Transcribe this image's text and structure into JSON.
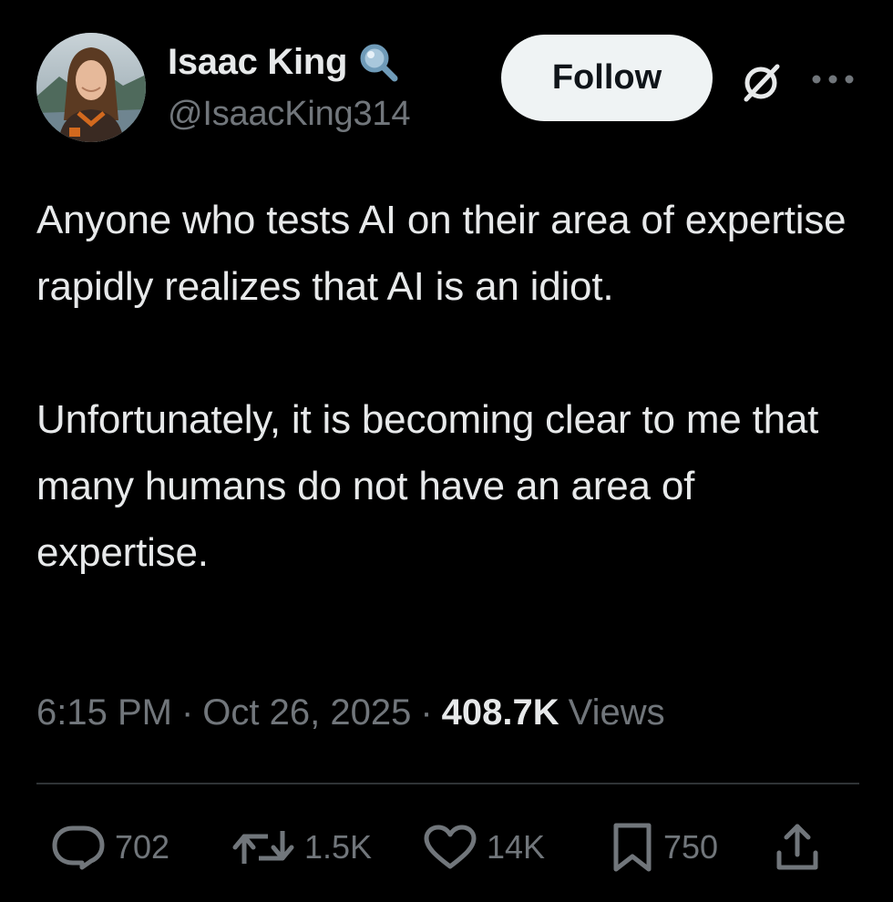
{
  "author": {
    "display_name": "Isaac King",
    "handle": "@IsaacKing314",
    "badge_icon": "magnifying-glass-icon",
    "avatar": "avatar"
  },
  "header": {
    "follow_label": "Follow",
    "grok_icon": "grok-icon",
    "more_icon": "more-icon"
  },
  "tweet": {
    "text": "Anyone who tests AI on their area of expertise rapidly realizes that AI is an idiot.\n\nUnfortunately, it is becoming clear to me that many humans do not have an area of expertise."
  },
  "meta": {
    "time": "6:15 PM",
    "separator": "·",
    "date": "Oct 26, 2025",
    "views_count": "408.7K",
    "views_label": "Views"
  },
  "actions": {
    "reply": {
      "icon": "reply-icon",
      "count": "702"
    },
    "repost": {
      "icon": "repost-icon",
      "count": "1.5K"
    },
    "like": {
      "icon": "heart-icon",
      "count": "14K"
    },
    "bookmark": {
      "icon": "bookmark-icon",
      "count": "750"
    },
    "share": {
      "icon": "share-icon"
    }
  },
  "colors": {
    "background": "#000000",
    "primary_text": "#e7e9ea",
    "secondary_text": "#71767b",
    "divider": "#2f3336",
    "follow_bg": "#eff3f4",
    "follow_text": "#0f1419"
  }
}
